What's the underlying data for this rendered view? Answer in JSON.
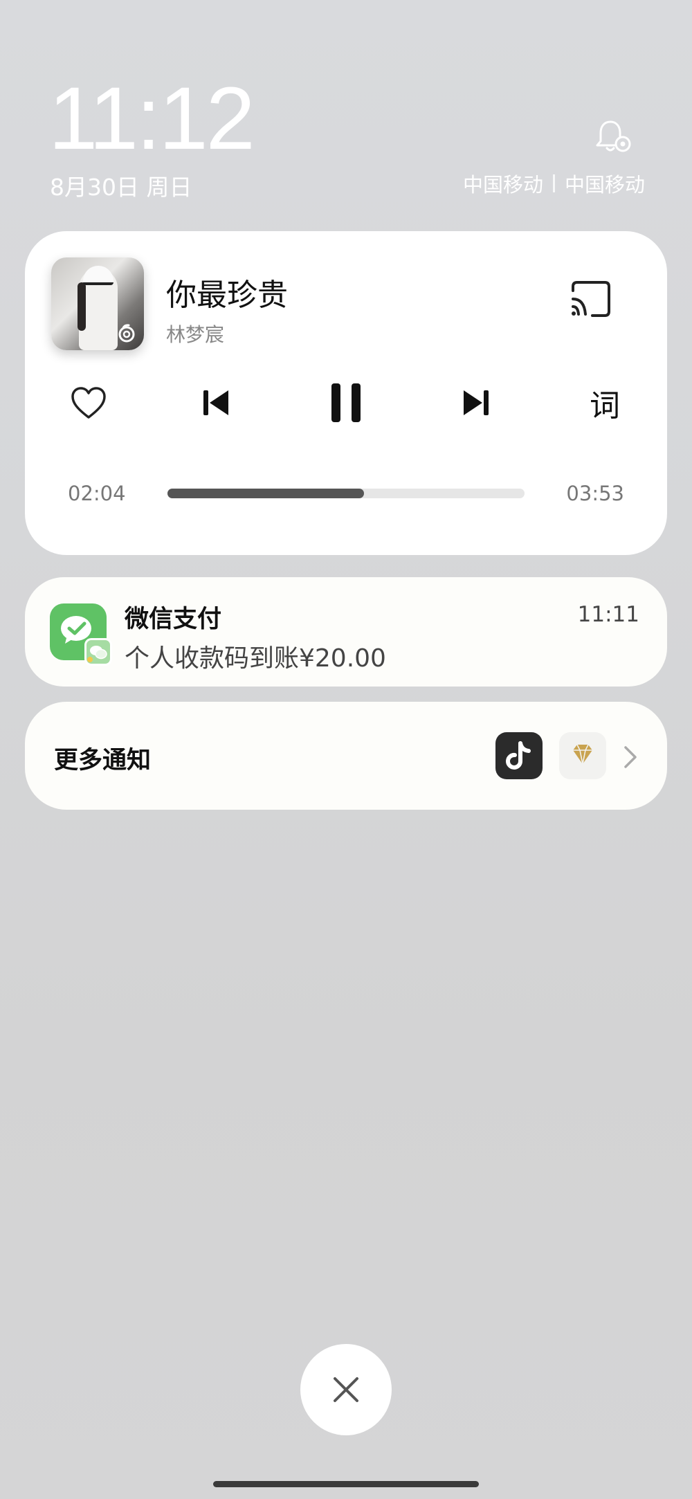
{
  "status": {
    "time": "11:12",
    "date": "8月30日 周日",
    "carrier1": "中国移动",
    "carrier2": "中国移动",
    "bell_icon": "bell-settings-icon"
  },
  "music": {
    "title": "你最珍贵",
    "artist": "林梦宸",
    "elapsed": "02:04",
    "duration": "03:53",
    "progress": 0.55,
    "lyrics_label": "词",
    "icons": {
      "like": "heart-icon",
      "previous": "previous-track-icon",
      "pause": "pause-icon",
      "next": "next-track-icon",
      "cast": "cast-icon"
    }
  },
  "notification": {
    "app": "微信支付",
    "body": "个人收款码到账¥20.00",
    "time": "11:11",
    "icon": "wechat-pay-icon"
  },
  "more": {
    "label": "更多通知",
    "apps": [
      "tiktok-icon",
      "diamond-icon"
    ]
  },
  "colors": {
    "wechat_green": "#5fc265",
    "progress_fill": "#555555",
    "card_bg": "#ffffff"
  }
}
